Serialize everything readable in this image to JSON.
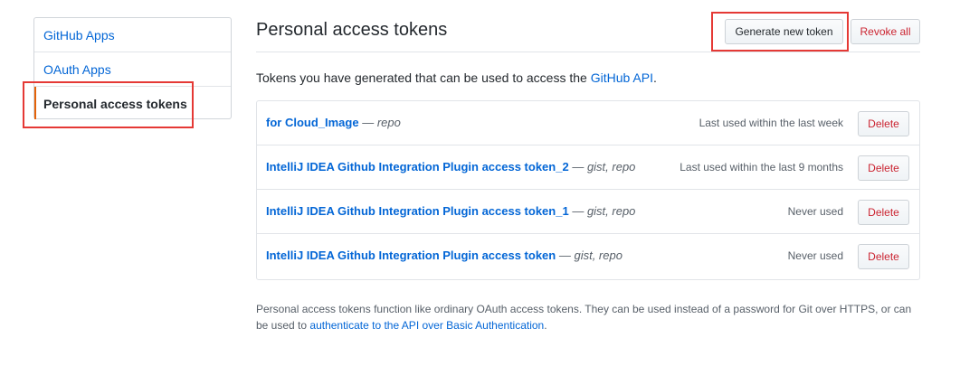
{
  "sidebar": {
    "items": [
      {
        "label": "GitHub Apps"
      },
      {
        "label": "OAuth Apps"
      },
      {
        "label": "Personal access tokens"
      }
    ]
  },
  "header": {
    "title": "Personal access tokens",
    "generate_label": "Generate new token",
    "revoke_label": "Revoke all"
  },
  "intro": {
    "text": "Tokens you have generated that can be used to access the ",
    "link": "GitHub API",
    "suffix": "."
  },
  "tokens": [
    {
      "name": "for Cloud_Image",
      "dash": " — ",
      "scopes": "repo",
      "last_used": "Last used within the last week",
      "delete_label": "Delete"
    },
    {
      "name": "IntelliJ IDEA Github Integration Plugin access token_2",
      "dash": " — ",
      "scopes": "gist, repo",
      "last_used": "Last used within the last 9 months",
      "delete_label": "Delete"
    },
    {
      "name": "IntelliJ IDEA Github Integration Plugin access token_1",
      "dash": " — ",
      "scopes": "gist, repo",
      "last_used": "Never used",
      "delete_label": "Delete"
    },
    {
      "name": "IntelliJ IDEA Github Integration Plugin access token",
      "dash": " — ",
      "scopes": "gist, repo",
      "last_used": "Never used",
      "delete_label": "Delete"
    }
  ],
  "footer": {
    "text1": "Personal access tokens function like ordinary OAuth access tokens. They can be used instead of a password for Git over HTTPS, or can be used to ",
    "link": "authenticate to the API over Basic Authentication",
    "suffix": "."
  },
  "colors": {
    "accent": "#0366d6",
    "danger": "#cb2431",
    "highlight": "#e53935",
    "selected_bar": "#e36209"
  }
}
